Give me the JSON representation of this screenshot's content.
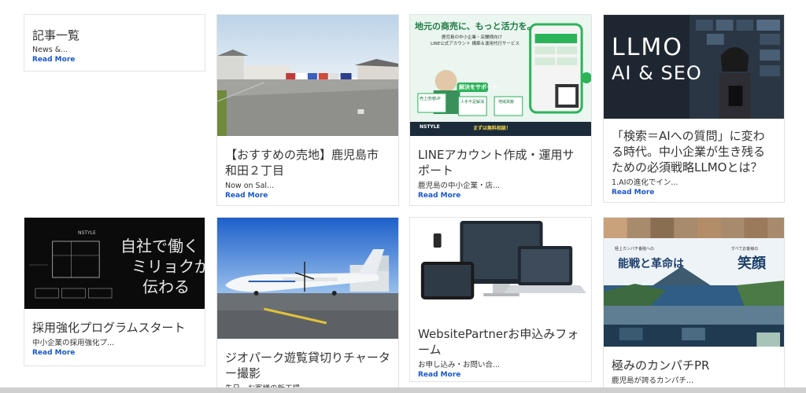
{
  "cards": [
    {
      "title": "記事一覧",
      "excerpt": "News &...",
      "more": "Read More"
    },
    {
      "title": "【おすすめの売地】鹿児島市 和田２丁目",
      "excerpt": "Now on Sal...",
      "more": "Read More"
    },
    {
      "title": "LINEアカウント作成・運用サポート",
      "excerpt": "鹿児島の中小企業・店...",
      "more": "Read More"
    },
    {
      "title": "「検索＝AIへの質問」に変わる時代。中小企業が生き残るための必須戦略LLMOとは？",
      "excerpt": "1.AIの進化でイン...",
      "more": "Read More"
    },
    {
      "title": "採用強化プログラムスタート",
      "excerpt": "中小企業の採用強化プ...",
      "more": "Read More"
    },
    {
      "title": "ジオパーク遊覧貸切りチャーター撮影",
      "excerpt": "先日、お客様の新工場...",
      "more": ""
    },
    {
      "title": "WebsitePartnerお申込みフォーム",
      "excerpt": "お申し込み・お問い合...",
      "more": "Read More"
    },
    {
      "title": "極みのカンパチPR",
      "excerpt": "鹿児島が誇るカンパチ...",
      "more": ""
    }
  ],
  "thumbs": {
    "line": {
      "headline": "地元の商売に、もっと活力を。",
      "sub1": "鹿児島の中小企業・店舗様向け",
      "sub2": "LINE公式アカウント 構築＆運用代行サービス",
      "badge": "解決をサポート！",
      "box1": "売上倍増UP",
      "box2": "人手不足解消",
      "box3": "地域貢献",
      "footer_brand": "NSTYLE",
      "footer_cta": "まずは無料相談！"
    },
    "llmo": {
      "line1": "LLMO",
      "line2": "AI & SEO"
    },
    "recruit": {
      "line1": "自社で働く",
      "line2": "ミリョクが",
      "line3": "伝わる",
      "brand": "NSTYLE"
    },
    "kanpachi": {
      "left": "能戦と革命は",
      "right": "笑顔",
      "tl": "極上カンパチ養殖への",
      "tr": "すべてお客様の"
    }
  }
}
